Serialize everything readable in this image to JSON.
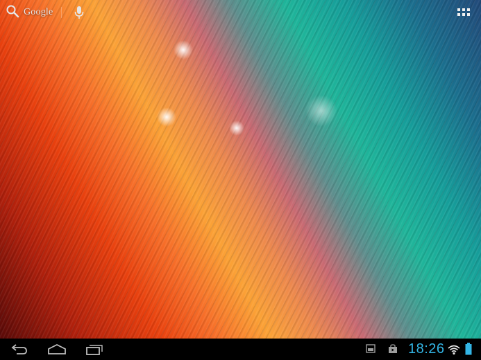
{
  "search": {
    "label": "Google"
  },
  "status": {
    "time": "18:26"
  },
  "icons": {
    "search": "search-icon",
    "voice": "microphone-icon",
    "apps": "apps-grid-icon",
    "back": "back-icon",
    "home": "home-icon",
    "recents": "recent-apps-icon",
    "screenshot": "screenshot-icon",
    "store": "store-icon",
    "wifi": "wifi-icon",
    "battery": "battery-icon"
  },
  "colors": {
    "accent": "#33b5e5",
    "navbar": "#000000"
  }
}
